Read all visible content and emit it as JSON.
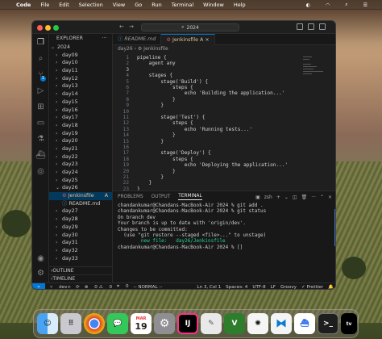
{
  "menubar": {
    "apple": "",
    "app": "Code",
    "items": [
      "File",
      "Edit",
      "Selection",
      "View",
      "Go",
      "Run",
      "Terminal",
      "Window",
      "Help"
    ]
  },
  "window": {
    "search": "2024",
    "icons": {
      "back": "arrow-left-icon",
      "forward": "arrow-right-icon",
      "search": "search-icon"
    }
  },
  "sidebar": {
    "header": "EXPLORER",
    "root": "2024",
    "folders_before": [
      "day09",
      "day10",
      "day11",
      "day12",
      "day13",
      "day14",
      "day15",
      "day16",
      "day17",
      "day18",
      "day19",
      "day20",
      "day21",
      "day22",
      "day23",
      "day24",
      "day25",
      "day26"
    ],
    "files": [
      {
        "name": "Jenkinsfile",
        "mark": "A"
      },
      {
        "name": "README.md",
        "mark": ""
      }
    ],
    "folders_after": [
      "day27",
      "day28",
      "day29",
      "day30",
      "day31",
      "day32",
      "day33"
    ],
    "outline": "OUTLINE",
    "timeline": "TIMELINE"
  },
  "tabs": [
    {
      "label": "README.md",
      "active": false
    },
    {
      "label": "Jenkinsfile",
      "mark": "A",
      "active": true
    }
  ],
  "breadcrumb": "day26 › ⚙ Jenkinsfile",
  "code": {
    "line_numbers": [
      "1",
      "2",
      "3",
      "4",
      "5",
      "6",
      "7",
      "8",
      "9",
      "10",
      "11",
      "12",
      "13",
      "14",
      "15",
      "16",
      "17",
      "18",
      "19",
      "20",
      "21",
      "22",
      "23"
    ],
    "lines": [
      "pipeline {",
      "    agent any",
      "",
      "    stages {",
      "        stage('Build') {",
      "            steps {",
      "                echo 'Building the application...'",
      "            }",
      "        }",
      "",
      "        stage('Test') {",
      "            steps {",
      "                echo 'Running tests...'",
      "            }",
      "        }",
      "",
      "        stage('Deploy') {",
      "            steps {",
      "                echo 'Deploying the application...'",
      "            }",
      "        }",
      "    }",
      "}"
    ]
  },
  "panel": {
    "tabs": [
      "PROBLEMS",
      "OUTPUT",
      "TERMINAL"
    ],
    "active_tab": "TERMINAL",
    "shell": "zsh",
    "terminal": [
      "chandankumar@Chandans-MacBook-Air 2024 % git add .",
      "chandankumar@Chandans-MacBook-Air 2024 % git status",
      "On branch dev",
      "Your branch is up to date with 'origin/dev'.",
      "",
      "Changes to be committed:",
      "  (use \"git restore --staged <file>...\" to unstage)",
      "        new file:   day26/Jenkinsfile",
      "",
      "chandankumar@Chandans-MacBook-Air 2024 % []"
    ]
  },
  "status": {
    "branch": "dev+",
    "sync": "⟳",
    "errors": "0",
    "warnings": "0",
    "ports": "0",
    "mode": "-- NORMAL --",
    "position": "Ln 3, Col 1",
    "spaces": "Spaces: 4",
    "encoding": "UTF-8",
    "eol": "LF",
    "lang": "Groovy",
    "prettier": "✓ Prettier"
  },
  "dock": {
    "items": [
      "Finder",
      "Launchpad",
      "Chrome",
      "Messages",
      "Calendar",
      "Settings",
      "IntelliJ",
      "Notes",
      "Terminal",
      "ChatGPT",
      "VS Code",
      "Docker",
      "Terminal",
      "Apple TV",
      "Trash"
    ],
    "calendar_day": "19",
    "calendar_month": "MAR"
  }
}
